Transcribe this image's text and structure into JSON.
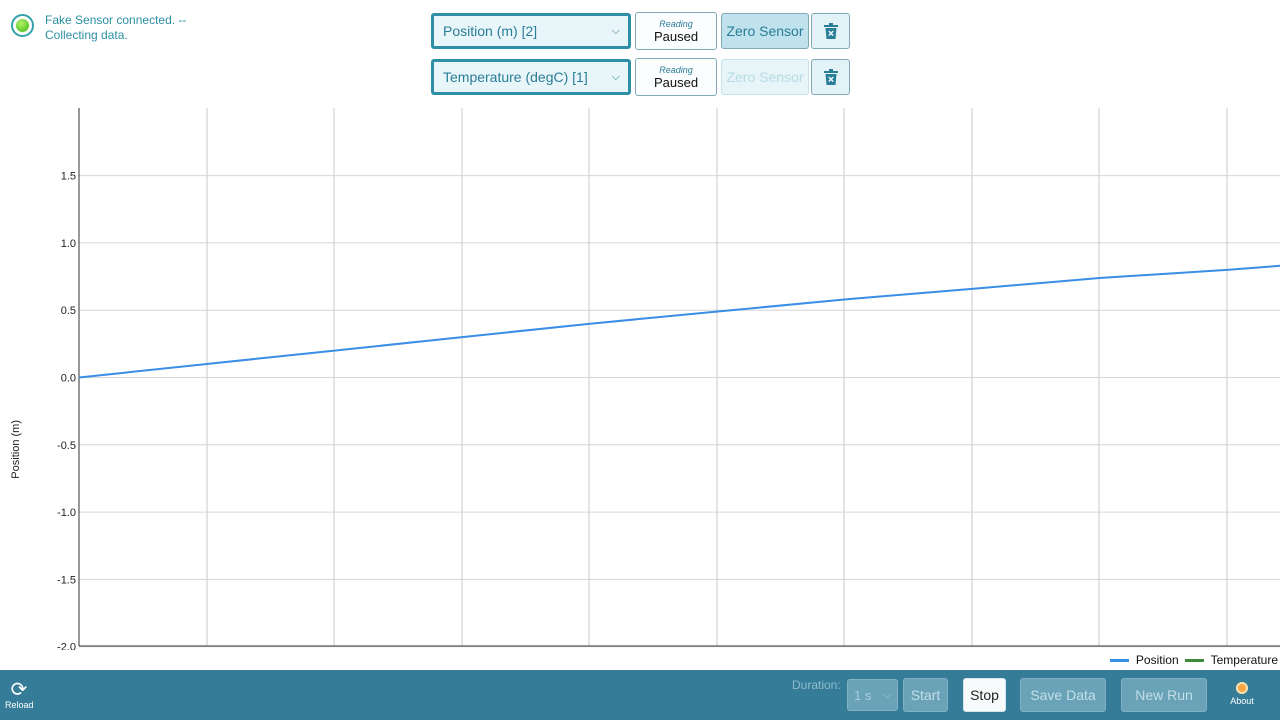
{
  "status": {
    "message": "Fake Sensor connected. -- Collecting data.",
    "indicator_color": "#5cc82a"
  },
  "sensors": [
    {
      "select_value": "Position (m) [2]",
      "reading_label": "Reading",
      "reading_value": "Paused",
      "zero_label": "Zero Sensor",
      "zero_enabled": true
    },
    {
      "select_value": "Temperature (degC) [1]",
      "reading_label": "Reading",
      "reading_value": "Paused",
      "zero_label": "Zero Sensor",
      "zero_enabled": false
    }
  ],
  "icons": {
    "trash": "trash-icon",
    "chevron": "chevron-down-icon",
    "reload": "reload-icon",
    "about": "lightbulb-icon",
    "status": "status-indicator-icon"
  },
  "chart_data": {
    "type": "line",
    "ylabel": "Position (m)",
    "ylim": [
      -2.05,
      1.95
    ],
    "yticks": [
      -2.0,
      -1.5,
      -1.0,
      -0.5,
      0.0,
      0.5,
      1.0,
      1.5
    ],
    "ytick_labels": [
      "-2.0",
      "-1.5",
      "-1.0",
      "-0.5",
      "0.0",
      "0.5",
      "1.0",
      "1.5"
    ],
    "grid": true,
    "legend_position": "bottom-right",
    "series": [
      {
        "name": "Position",
        "color": "#3a8ee6",
        "x": [
          0.0,
          0.5,
          1.0,
          1.5,
          2.0,
          2.5,
          3.0,
          3.5,
          4.0,
          4.5,
          4.7
        ],
        "y": [
          0.0,
          0.1,
          0.2,
          0.3,
          0.4,
          0.49,
          0.58,
          0.66,
          0.74,
          0.8,
          0.83
        ]
      },
      {
        "name": "Temperature",
        "color": "#3d8a3a",
        "x": [],
        "y": []
      }
    ],
    "xlim": [
      0.0,
      4.7
    ]
  },
  "footer": {
    "reload_label": "Reload",
    "duration_label": "Duration:",
    "duration_value": "1 s",
    "start_label": "Start",
    "stop_label": "Stop",
    "save_label": "Save Data",
    "new_run_label": "New Run",
    "about_label": "About"
  }
}
